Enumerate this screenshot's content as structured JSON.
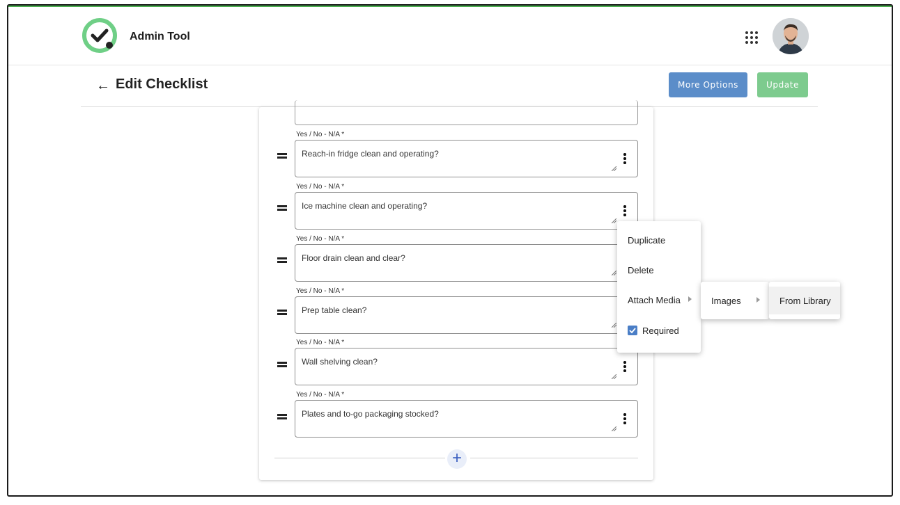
{
  "app": {
    "title": "Admin Tool"
  },
  "header": {
    "page_title": "Edit Checklist",
    "more_options_label": "More Options",
    "update_label": "Update"
  },
  "checklist": {
    "items": [
      {
        "label": "Yes / No - N/A *",
        "text": "Reach-in fridge clean and operating?"
      },
      {
        "label": "Yes / No - N/A *",
        "text": "Ice machine clean and operating?"
      },
      {
        "label": "Yes / No - N/A *",
        "text": "Floor drain clean and clear?"
      },
      {
        "label": "Yes / No - N/A *",
        "text": "Prep table clean?"
      },
      {
        "label": "Yes / No - N/A *",
        "text": "Wall shelving clean?"
      },
      {
        "label": "Yes / No - N/A *",
        "text": "Plates and to-go packaging stocked?"
      }
    ],
    "add_icon": "+"
  },
  "context_menu": {
    "duplicate": "Duplicate",
    "delete": "Delete",
    "attach_media": "Attach Media",
    "required": "Required",
    "required_checked": true
  },
  "submenu": {
    "images": "Images"
  },
  "subsubmenu": {
    "from_library": "From Library"
  },
  "colors": {
    "accent_blue": "#5b8dc9",
    "accent_green": "#7dcb8e",
    "logo_green": "#6fcf86"
  },
  "icons": {
    "back": "arrow-left-icon",
    "apps": "grid-icon",
    "drag": "drag-handle-icon",
    "kebab": "kebab-icon",
    "add": "plus-icon"
  }
}
